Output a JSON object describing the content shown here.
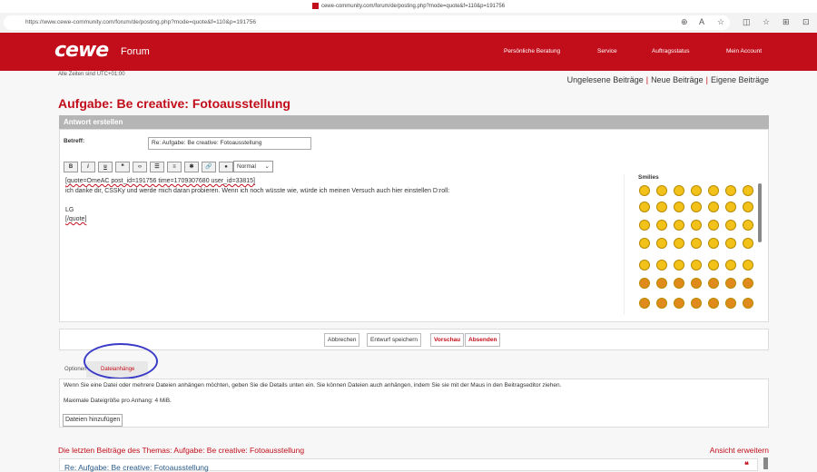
{
  "browser": {
    "tab_title": "cewe-community.com/forum/de/posting.php?mode=quote&f=110&p=191756",
    "url": "https://www.cewe-community.com/forum/de/posting.php?mode=quote&f=110&p=191756"
  },
  "header": {
    "logo": "cewe",
    "forum": "Forum",
    "nav": [
      "Persönliche Beratung",
      "Service",
      "Auftragsstatus",
      "Mein Account"
    ]
  },
  "timezone": "Alle Zeiten sind UTC+01:00",
  "quicklinks": [
    "Ungelesene Beiträge",
    "Neue Beiträge",
    "Eigene Beiträge"
  ],
  "page_title": "Aufgabe: Be creative: Fotoausstellung",
  "form": {
    "heading": "Antwort erstellen",
    "subject_label": "Betreff:",
    "subject_value": "Re: Aufgabe: Be creative: Fotoausstellung",
    "toolbar": [
      "B",
      "i",
      "u",
      "❝",
      "‹›",
      "☰",
      "≡",
      "✱",
      "🔗",
      "●"
    ],
    "font_size": "Normal",
    "editor_lines": [
      "[quote=OmeAC post_id=191756 time=1709307680 user_id=33815]",
      "ich danke dir, CSSKy und werde mich daran probieren. Wenn ich noch wüsste wie, würde ich meinen Versuch auch hier einstellen D:roll:",
      "",
      "LG",
      "[/quote]"
    ],
    "smilies_label": "Smilies"
  },
  "buttons": {
    "cancel": "Abbrechen",
    "save_draft": "Entwurf speichern",
    "preview": "Vorschau",
    "submit": "Absenden"
  },
  "tabs": {
    "options": "Optionen",
    "attachments": "Dateianhänge"
  },
  "attachments": {
    "info": "Wenn Sie eine Datei oder mehrere Dateien anhängen möchten, geben Sie die Details unten ein. Sie können Dateien auch anhängen, indem Sie sie mit der Maus in den Beitragseditor ziehen.",
    "max_size": "Maximale Dateigröße pro Anhang: 4 MiB.",
    "add_button": "Dateien hinzufügen"
  },
  "recent": {
    "title": "Die letzten Beiträge des Themas: Aufgabe: Be creative: Fotoausstellung",
    "expand": "Ansicht erweitern",
    "post_title": "Re: Aufgabe: Be creative: Fotoausstellung"
  }
}
